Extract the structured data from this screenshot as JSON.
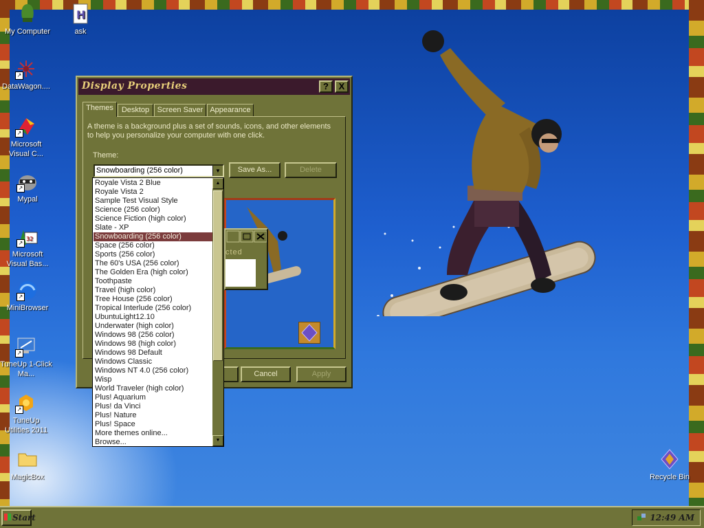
{
  "desktop": {
    "icons": [
      {
        "label": "My Computer",
        "icon": "my-computer-icon"
      },
      {
        "label": "ask",
        "icon": "document-h-icon"
      },
      {
        "label": "DataWagon....",
        "icon": "datawagon-icon"
      },
      {
        "label": "Microsoft Visual C...",
        "icon": "visual-c-icon"
      },
      {
        "label": "Mypal",
        "icon": "mypal-raccoon-icon"
      },
      {
        "label": "Microsoft Visual Bas...",
        "icon": "visual-basic-icon"
      },
      {
        "label": "MiniBrowser",
        "icon": "minibrowser-globe-icon"
      },
      {
        "label": "TuneUp 1-Click Ma...",
        "icon": "tuneup-monitor-icon"
      },
      {
        "label": "TuneUp Utilities 2011",
        "icon": "tuneup-puzzle-icon"
      },
      {
        "label": "MagicBox",
        "icon": "folder-icon"
      },
      {
        "label": "Recycle Bin",
        "icon": "recycle-bin-icon"
      }
    ]
  },
  "dialog": {
    "title": "Display Properties",
    "tabs": [
      "Themes",
      "Desktop",
      "Screen Saver",
      "Appearance"
    ],
    "active_tab": "Themes",
    "description": "A theme is a background plus a set of sounds, icons, and other elements to help you personalize your computer with one click.",
    "theme_label": "Theme:",
    "theme_value": "Snowboarding (256 color)",
    "save_as": "Save As...",
    "delete": "Delete",
    "preview_caption": "cted",
    "cancel": "Cancel",
    "apply": "Apply",
    "help_glyph": "?",
    "close_glyph": "X"
  },
  "dropdown": {
    "items": [
      "Royale Vista 2 Blue",
      "Royale Vista 2",
      "Sample Test Visual Style",
      "Science (256 color)",
      "Science Fiction (high color)",
      "Slate - XP",
      "Snowboarding (256 color)",
      "Space (256 color)",
      "Sports (256 color)",
      "The 60's USA (256 color)",
      "The Golden Era (high color)",
      "Toothpaste",
      "Travel (high color)",
      "Tree House (256 color)",
      "Tropical Interlude (256 color)",
      "UbuntuLight12.10",
      "Underwater (high color)",
      "Windows 98 (256 color)",
      "Windows 98 (high color)",
      "Windows 98 Default",
      "Windows Classic",
      "Windows NT 4.0 (256 color)",
      "Wisp",
      "World Traveler (high color)",
      "Plus! Aquarium",
      "Plus! da Vinci",
      "Plus! Nature",
      "Plus! Space",
      "More themes online...",
      "Browse..."
    ],
    "selected": "Snowboarding (256 color)"
  },
  "taskbar": {
    "start_label": "Start",
    "clock": "12:49 AM"
  },
  "colors": {
    "window_face": "#6f7339",
    "title_bar": "#3b1a2c",
    "selection": "#7b3b3c",
    "sky": "#1e5fcf"
  }
}
